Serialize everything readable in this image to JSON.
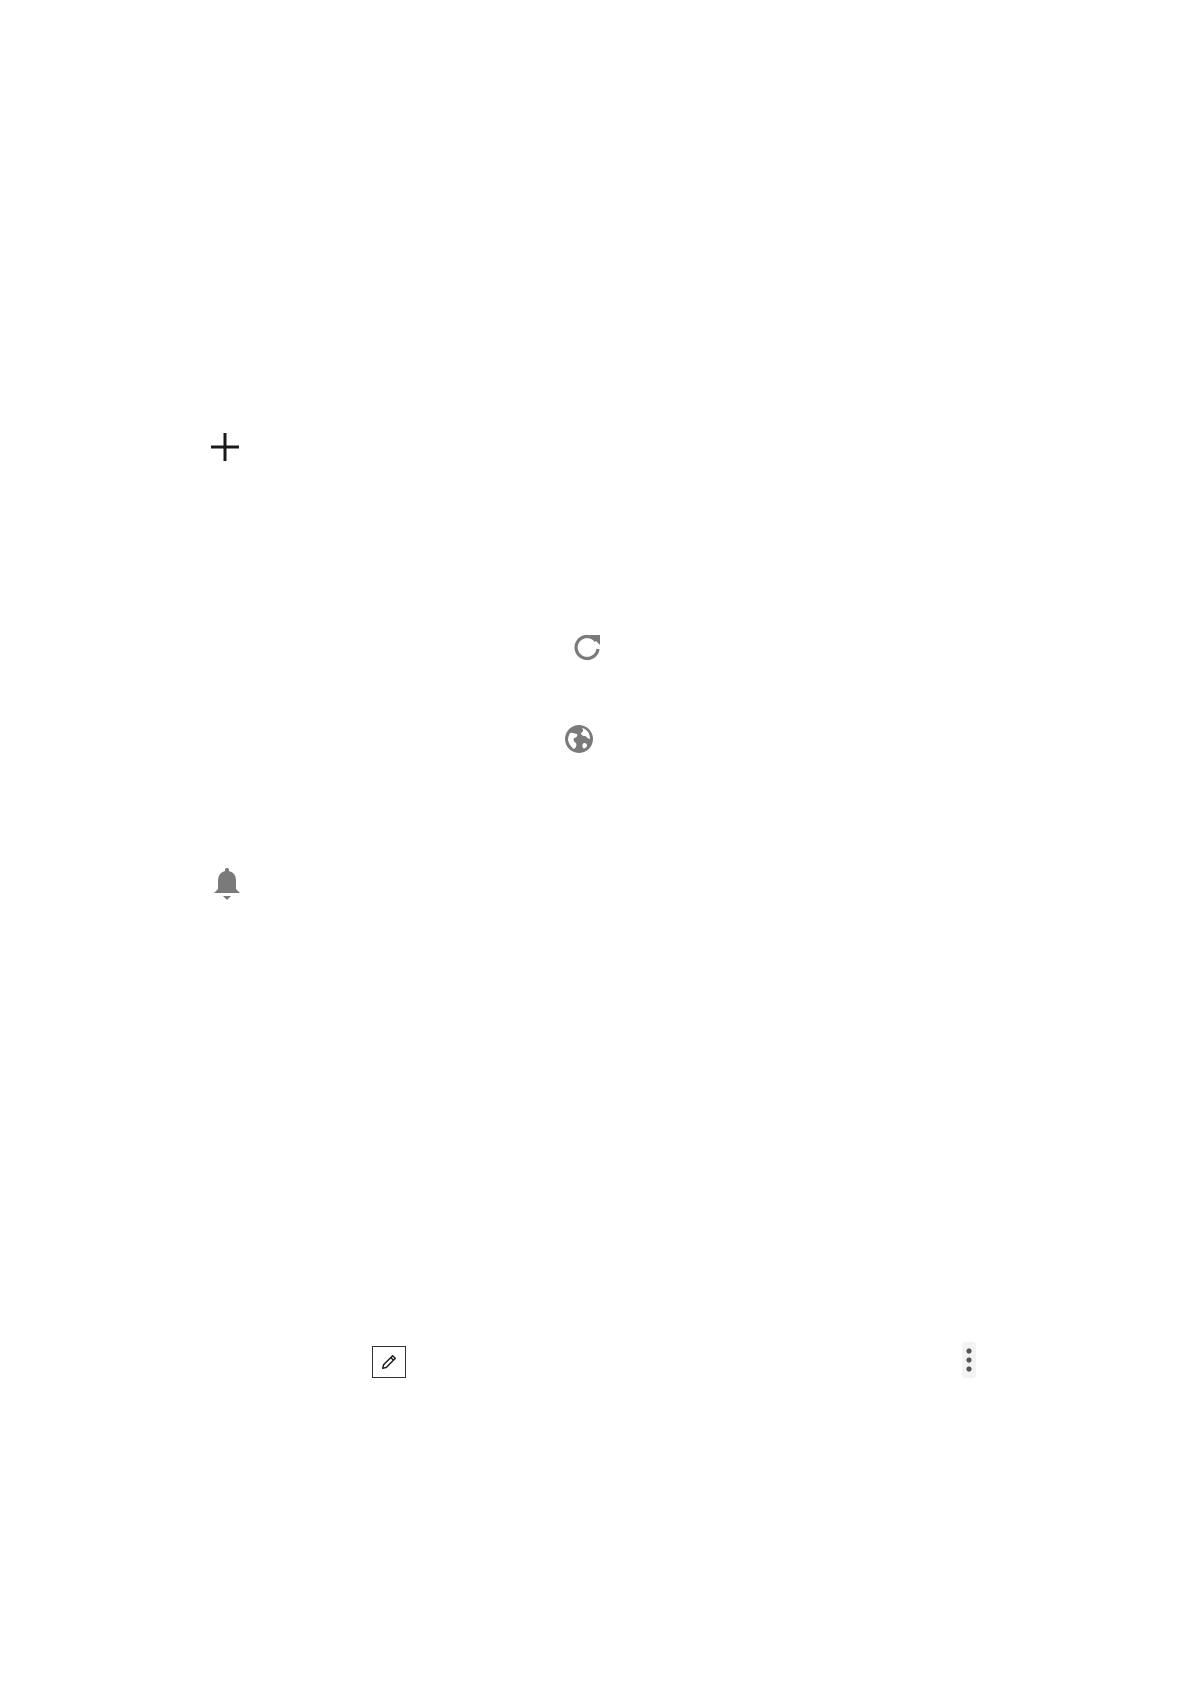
{
  "icons": {
    "add": "plus-icon",
    "refresh": "refresh-icon",
    "globe": "globe-icon",
    "notification": "bell-icon",
    "edit": "pencil-icon",
    "more": "more-vertical-icon"
  },
  "colors": {
    "dark": "#1a1a1a",
    "gray": "#7a7a7a",
    "border": "#333333",
    "more_bg": "#f3f3f3",
    "background": "#ffffff"
  }
}
